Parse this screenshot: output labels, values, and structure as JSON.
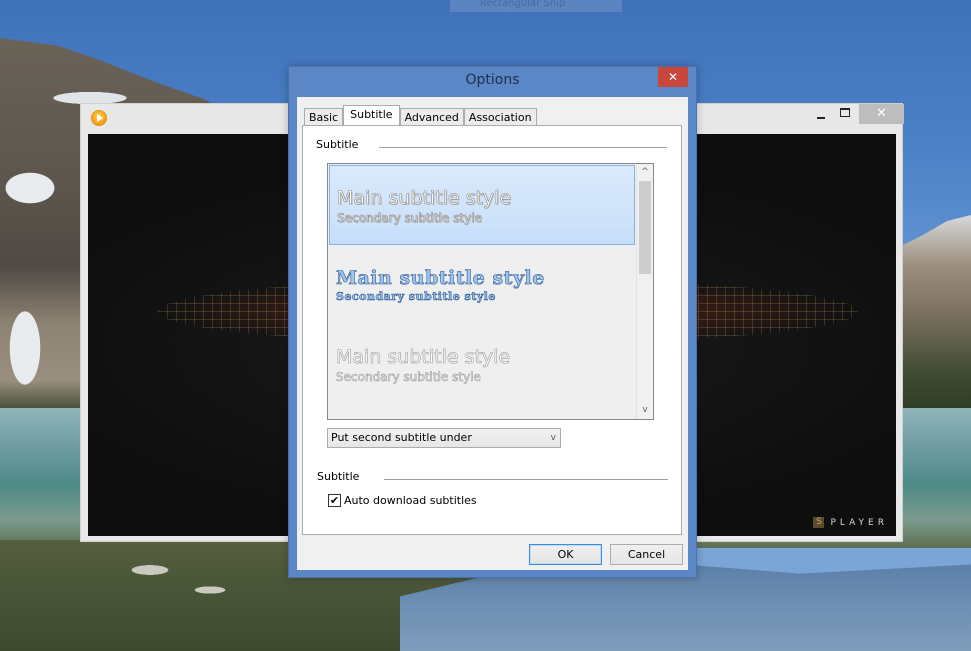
{
  "desktop": {
    "background_hint_text": "Rectangular Snip"
  },
  "player": {
    "app_icon": "splayer-play-icon",
    "window_controls": {
      "minimize": "minimize-icon",
      "maximize": "maximize-icon",
      "close": "✕"
    },
    "brand_badge": {
      "logo_letter": "S",
      "text": "PLAYER"
    }
  },
  "dialog": {
    "title": "Options",
    "close_glyph": "✕",
    "tabs": [
      {
        "label": "Basic",
        "active": false
      },
      {
        "label": "Subtitle",
        "active": true
      },
      {
        "label": "Advanced",
        "active": false
      },
      {
        "label": "Association",
        "active": false
      }
    ],
    "subtitle_group": {
      "label": "Subtitle",
      "styles": [
        {
          "main": "Main subtitle style",
          "secondary": "Secondary subtitle style",
          "selected": true
        },
        {
          "main": "Main subtitle style",
          "secondary": "Secondary subtitle style",
          "selected": false
        },
        {
          "main": "Main subtitle style",
          "secondary": "Secondary subtitle style",
          "selected": false
        }
      ],
      "scroll_up": "^",
      "scroll_down": "v",
      "position_select": {
        "value": "Put second subtitle under",
        "arrow": "v"
      }
    },
    "download_group": {
      "label": "Subtitle",
      "auto_download": {
        "label": "Auto download subtitles",
        "checked": true,
        "check_glyph": "✔"
      }
    },
    "buttons": {
      "ok": "OK",
      "cancel": "Cancel"
    }
  },
  "colors": {
    "dialog_frame": "#5b87c6",
    "close_red": "#c9463d",
    "selection_blue": "#c7defa",
    "ok_focus_border": "#3c8ddb"
  }
}
